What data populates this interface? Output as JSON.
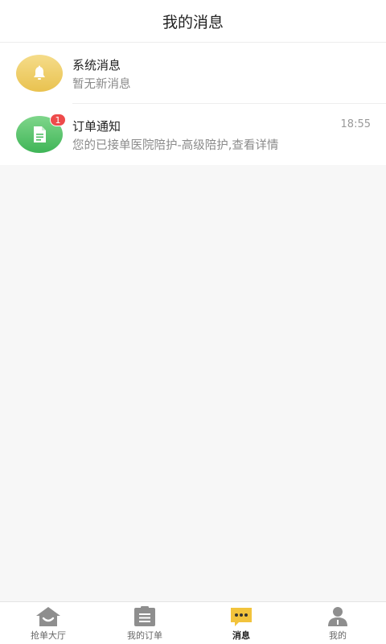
{
  "header": {
    "title": "我的消息"
  },
  "messages": [
    {
      "title": "系统消息",
      "subtitle": "暂无新消息",
      "time": "",
      "badge": "",
      "icon": "bell-icon",
      "color": "#e9c24f"
    },
    {
      "title": "订单通知",
      "subtitle": "您的已接单医院陪护-高级陪护,查看详情",
      "time": "18:55",
      "badge": "1",
      "icon": "document-icon",
      "color": "#3fb557"
    }
  ],
  "tabbar": {
    "items": [
      {
        "label": "抢单大厅",
        "icon": "house-icon"
      },
      {
        "label": "我的订单",
        "icon": "clipboard-icon"
      },
      {
        "label": "消息",
        "icon": "chat-bubble-icon"
      },
      {
        "label": "我的",
        "icon": "person-icon"
      }
    ],
    "active_index": 2,
    "active_color": "#f2c33c",
    "inactive_color": "#8e8e8e"
  }
}
